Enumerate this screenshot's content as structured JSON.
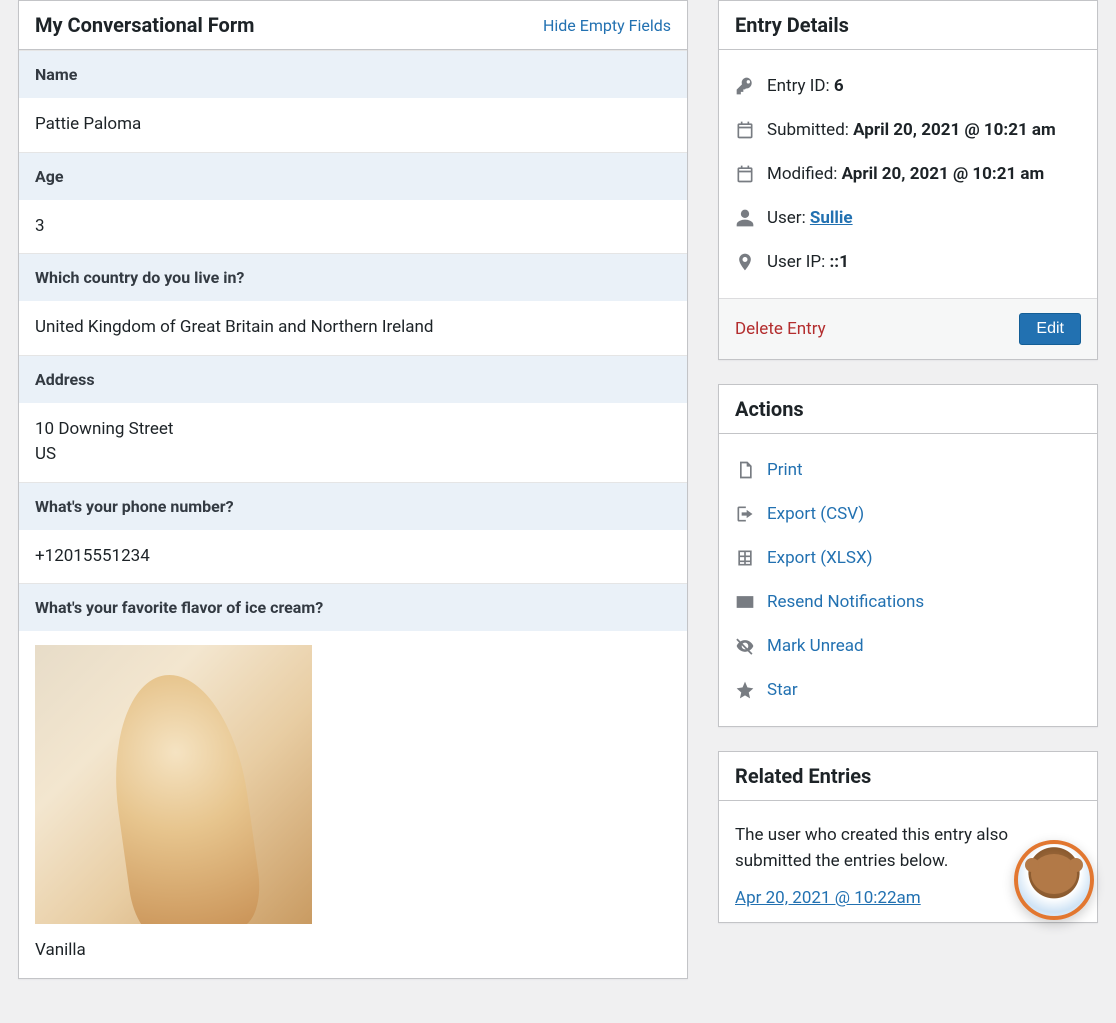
{
  "form": {
    "title": "My Conversational Form",
    "hide_empty": "Hide Empty Fields",
    "fields": {
      "name_label": "Name",
      "name_value": "Pattie Paloma",
      "age_label": "Age",
      "age_value": "3",
      "country_label": "Which country do you live in?",
      "country_value": "United Kingdom of Great Britain and Northern Ireland",
      "address_label": "Address",
      "address_line1": "10 Downing Street",
      "address_line2": "US",
      "phone_label": "What's your phone number?",
      "phone_value": "+12015551234",
      "flavor_label": "What's your favorite flavor of ice cream?",
      "flavor_value": "Vanilla"
    }
  },
  "entry_details": {
    "title": "Entry Details",
    "entry_id_label": "Entry ID: ",
    "entry_id_value": "6",
    "submitted_label": "Submitted: ",
    "submitted_value": "April 20, 2021 @ 10:21 am",
    "modified_label": "Modified: ",
    "modified_value": "April 20, 2021 @ 10:21 am",
    "user_label": "User: ",
    "user_value": "Sullie",
    "user_ip_label": "User IP: ",
    "user_ip_value": "::1",
    "delete_label": "Delete Entry",
    "edit_label": "Edit"
  },
  "actions": {
    "title": "Actions",
    "print": "Print",
    "export_csv": "Export (CSV)",
    "export_xlsx": "Export (XLSX)",
    "resend": "Resend Notifications",
    "mark_unread": "Mark Unread",
    "star": "Star"
  },
  "related": {
    "title": "Related Entries",
    "text": "The user who created this entry also submitted the entries below.",
    "link": "Apr 20, 2021 @ 10:22am"
  }
}
